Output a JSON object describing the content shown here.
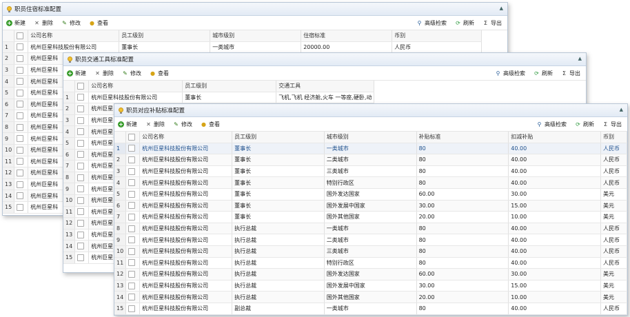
{
  "toolbar": {
    "new": "新建",
    "delete": "删除",
    "edit": "修改",
    "view": "查看",
    "advanced_search": "高级检索",
    "refresh": "刷新",
    "export": "导出"
  },
  "icons": {
    "title": "lightbulb-icon",
    "new": "plus-circle-icon",
    "delete": "x-icon",
    "edit": "pencil-icon",
    "view": "lightbulb-icon",
    "search": "magnifier-icon",
    "refresh": "refresh-icon",
    "export": "sigma-icon"
  },
  "panel1": {
    "title": "职员住宿标准配置",
    "columns": [
      "公司名称",
      "员工级别",
      "城市级别",
      "住宿标准",
      "币别"
    ],
    "first_row": [
      "杭州巨星科技股份有限公司",
      "董事长",
      "一类城市",
      "20000.00",
      "人民币"
    ],
    "row_prefix": "杭州巨星科",
    "row_numbers": [
      "1",
      "2",
      "3",
      "4",
      "5",
      "6",
      "7",
      "8",
      "9",
      "10",
      "11",
      "12",
      "13",
      "14",
      "15"
    ]
  },
  "panel2": {
    "title": "职员交通工具标准配置",
    "columns": [
      "公司名称",
      "员工级别",
      "交通工具"
    ],
    "first_row": [
      "杭州巨星科技股份有限公司",
      "董事长",
      "飞机,飞机 经济舱,火车 一等座,硬卧,动"
    ],
    "row_prefix": "杭州巨星",
    "row_numbers": [
      "1",
      "2",
      "3",
      "4",
      "5",
      "6",
      "7",
      "8",
      "9",
      "10",
      "11",
      "12",
      "13",
      "14",
      "15"
    ]
  },
  "panel3": {
    "title": "职员对应补贴标准配置",
    "columns": [
      "公司名称",
      "员工级别",
      "城市级别",
      "补贴标准",
      "扣减补贴",
      "币别"
    ],
    "rows": [
      [
        "1",
        "杭州巨星科技股份有限公司",
        "董事长",
        "一类城市",
        "80",
        "40.00",
        "人民币"
      ],
      [
        "2",
        "杭州巨星科技股份有限公司",
        "董事长",
        "二类城市",
        "80",
        "40.00",
        "人民币"
      ],
      [
        "3",
        "杭州巨星科技股份有限公司",
        "董事长",
        "三类城市",
        "80",
        "40.00",
        "人民币"
      ],
      [
        "4",
        "杭州巨星科技股份有限公司",
        "董事长",
        "特别行政区",
        "80",
        "40.00",
        "人民币"
      ],
      [
        "5",
        "杭州巨星科技股份有限公司",
        "董事长",
        "国外发达国家",
        "60.00",
        "30.00",
        "美元"
      ],
      [
        "6",
        "杭州巨星科技股份有限公司",
        "董事长",
        "国外发展中国家",
        "30.00",
        "15.00",
        "美元"
      ],
      [
        "7",
        "杭州巨星科技股份有限公司",
        "董事长",
        "国外其他国家",
        "20.00",
        "10.00",
        "美元"
      ],
      [
        "8",
        "杭州巨星科技股份有限公司",
        "执行总裁",
        "一类城市",
        "80",
        "40.00",
        "人民币"
      ],
      [
        "9",
        "杭州巨星科技股份有限公司",
        "执行总裁",
        "二类城市",
        "80",
        "40.00",
        "人民币"
      ],
      [
        "10",
        "杭州巨星科技股份有限公司",
        "执行总裁",
        "三类城市",
        "80",
        "40.00",
        "人民币"
      ],
      [
        "11",
        "杭州巨星科技股份有限公司",
        "执行总裁",
        "特别行政区",
        "80",
        "40.00",
        "人民币"
      ],
      [
        "12",
        "杭州巨星科技股份有限公司",
        "执行总裁",
        "国外发达国家",
        "60.00",
        "30.00",
        "美元"
      ],
      [
        "13",
        "杭州巨星科技股份有限公司",
        "执行总裁",
        "国外发展中国家",
        "30.00",
        "15.00",
        "美元"
      ],
      [
        "14",
        "杭州巨星科技股份有限公司",
        "执行总裁",
        "国外其他国家",
        "20.00",
        "10.00",
        "美元"
      ],
      [
        "15",
        "杭州巨星科技股份有限公司",
        "副总裁",
        "一类城市",
        "80",
        "40.00",
        "人民币"
      ]
    ]
  }
}
